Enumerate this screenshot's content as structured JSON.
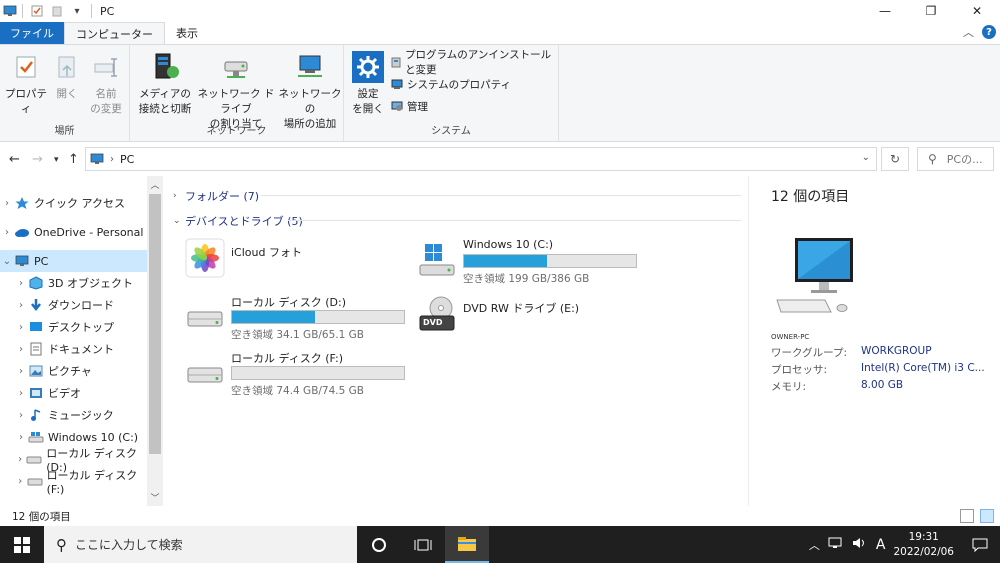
{
  "titlebar": {
    "title": "PC"
  },
  "ribbon_tabs": {
    "file": "ファイル",
    "computer": "コンピューター",
    "view": "表示"
  },
  "ribbon": {
    "location": {
      "label": "場所",
      "properties": "プロパティ",
      "open": "開く",
      "rename_1": "名前",
      "rename_2": "の変更"
    },
    "network": {
      "label": "ネットワーク",
      "media_1": "メディアの",
      "media_2": "接続と切断",
      "map_1": "ネットワーク ドライブ",
      "map_2": "の割り当て",
      "add_1": "ネットワークの",
      "add_2": "場所の追加"
    },
    "system": {
      "label": "システム",
      "settings_1": "設定",
      "settings_2": "を開く",
      "uninstall": "プログラムのアンインストールと変更",
      "sys_props": "システムのプロパティ",
      "manage": "管理"
    }
  },
  "address": {
    "path": "PC",
    "search_placeholder": "PCの..."
  },
  "nav": {
    "items": [
      {
        "label": "クイック アクセス"
      },
      {
        "label": "OneDrive - Personal"
      },
      {
        "label": "PC"
      },
      {
        "label": "3D オブジェクト"
      },
      {
        "label": "ダウンロード"
      },
      {
        "label": "デスクトップ"
      },
      {
        "label": "ドキュメント"
      },
      {
        "label": "ピクチャ"
      },
      {
        "label": "ビデオ"
      },
      {
        "label": "ミュージック"
      },
      {
        "label": "Windows 10 (C:)"
      },
      {
        "label": "ローカル ディスク (D:)"
      },
      {
        "label": "ローカル ディスク (F:)"
      }
    ]
  },
  "main": {
    "folders_header": "フォルダー (7)",
    "devices_header": "デバイスとドライブ (5)",
    "tiles": [
      {
        "name": "iCloud フォト"
      },
      {
        "name": "Windows 10 (C:)",
        "free": "空き領域 199 GB/386 GB",
        "used_fraction": 0.48
      },
      {
        "name": "ローカル ディスク (D:)",
        "free": "空き領域 34.1 GB/65.1 GB",
        "used_fraction": 0.48
      },
      {
        "name": "DVD RW ドライブ (E:)",
        "dvd_label": "DVD"
      },
      {
        "name": "ローカル ディスク (F:)",
        "free": "空き領域 74.4 GB/74.5 GB",
        "used_fraction": 0.0
      }
    ]
  },
  "details": {
    "title": "12 個の項目",
    "pc_name": "OWNER-PC",
    "rows": [
      {
        "key": "ワークグループ:",
        "value": "WORKGROUP"
      },
      {
        "key": "プロセッサ:",
        "value": "Intel(R) Core(TM) i3 C..."
      },
      {
        "key": "メモリ:",
        "value": "8.00 GB"
      }
    ]
  },
  "status": {
    "count": "12 個の項目"
  },
  "taskbar": {
    "search_placeholder": "ここに入力して検索",
    "ime": "A",
    "time": "19:31",
    "date": "2022/02/06"
  },
  "colors": {
    "accent": "#1a6fc2",
    "bar_fill": "#26a0da",
    "selection": "#cce8ff"
  }
}
